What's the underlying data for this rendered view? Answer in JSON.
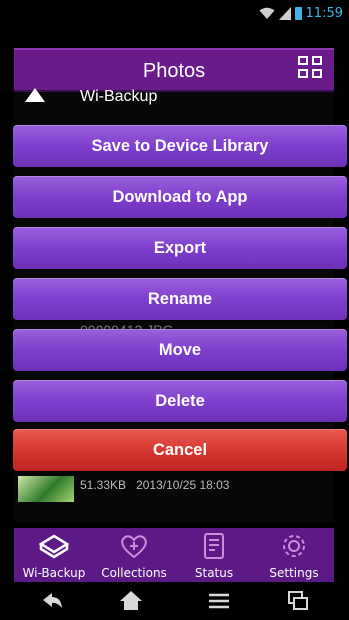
{
  "status_bar": {
    "time": "11:59",
    "icons": [
      "wifi-icon",
      "signal-icon",
      "battery-icon"
    ]
  },
  "header": {
    "title": "Photos",
    "select_all_icon": "select-all-checkbox-icon"
  },
  "background_list": {
    "items": [
      {
        "label": "Wi-Backup"
      },
      {
        "label": "00000412.JPG"
      },
      {
        "size": "51.33KB",
        "date": "2013/10/25 18:03"
      }
    ]
  },
  "action_menu": {
    "items": [
      {
        "label": "Save to Device Library"
      },
      {
        "label": "Download to App"
      },
      {
        "label": "Export"
      },
      {
        "label": "Rename"
      },
      {
        "label": "Move"
      },
      {
        "label": "Delete"
      }
    ],
    "cancel": "Cancel"
  },
  "tabs": [
    {
      "label": "Wi-Backup",
      "icon": "backup-icon",
      "active": true
    },
    {
      "label": "Collections",
      "icon": "heart-icon",
      "active": false
    },
    {
      "label": "Status",
      "icon": "status-doc-icon",
      "active": false
    },
    {
      "label": "Settings",
      "icon": "gear-icon",
      "active": false
    }
  ],
  "nav": {
    "icons": [
      "back-icon",
      "home-icon",
      "menu-icon",
      "recent-apps-icon"
    ]
  },
  "colors": {
    "menu_purple": "#7f3fcd",
    "cancel_red": "#d5362f",
    "tabbar": "#5d1a86",
    "status_blue": "#3fb6e8"
  }
}
